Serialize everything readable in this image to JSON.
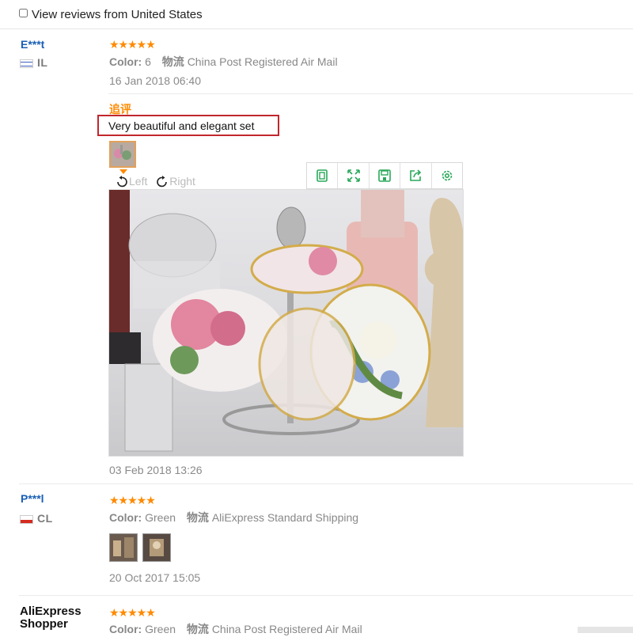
{
  "filter": {
    "label": "View reviews from United States"
  },
  "reviews": [
    {
      "user": "E***t",
      "country": "IL",
      "stars": "★★★★★",
      "color_label": "Color:",
      "color_value": "6",
      "shipping_label": "物流",
      "shipping_value": "China Post Registered Air Mail",
      "date": "16 Jan 2018 06:40",
      "followup_label": "追评",
      "followup_text": "Very beautiful and elegant set",
      "rotate_left": "Left",
      "rotate_right": "Right",
      "followup_date": "03 Feb 2018 13:26"
    },
    {
      "user": "P***l",
      "country": "CL",
      "stars": "★★★★★",
      "color_label": "Color:",
      "color_value": "Green",
      "shipping_label": "物流",
      "shipping_value": "AliExpress Standard Shipping",
      "date": "20 Oct 2017 15:05"
    },
    {
      "user_line1": "AliExpress",
      "user_line2": "Shopper",
      "stars": "★★★★★",
      "color_label": "Color:",
      "color_value": "Green",
      "shipping_label": "物流",
      "shipping_value": "China Post Registered Air Mail"
    }
  ],
  "toolbar": {
    "icons": [
      "fit-icon",
      "fullscreen-icon",
      "save-icon",
      "share-icon",
      "settings-icon"
    ]
  },
  "colors": {
    "accent": "#ff8a00",
    "user": "#1a5fb4",
    "highlight": "#c1272d",
    "tool": "#2aa85a"
  }
}
